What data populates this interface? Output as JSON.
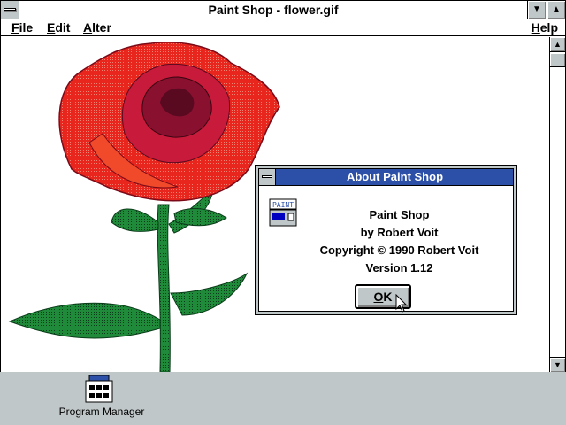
{
  "window": {
    "title": "Paint Shop - flower.gif",
    "minimize_glyph": "▼",
    "maximize_glyph": "▲"
  },
  "menu": {
    "file": {
      "hot": "F",
      "rest": "ile"
    },
    "edit": {
      "hot": "E",
      "rest": "dit"
    },
    "alter": {
      "hot": "A",
      "rest": "lter"
    },
    "help": {
      "hot": "H",
      "rest": "elp"
    }
  },
  "scrollbar": {
    "up_glyph": "▲",
    "down_glyph": "▼"
  },
  "dialog": {
    "title": "About Paint Shop",
    "app_name": "Paint Shop",
    "author": "by Robert Voit",
    "copyright": "Copyright © 1990 Robert Voit",
    "version": "Version 1.12",
    "ok": {
      "hot": "O",
      "rest": "K"
    },
    "icon_label": "PAINT"
  },
  "desktop": {
    "program_manager_label": "Program Manager"
  },
  "colors": {
    "desktop": "#c0c7c8",
    "dialog_title": "#2c50a8",
    "rose_red": "#e8261e",
    "rose_dark": "#8a1030",
    "leaf_green": "#1f8a3a"
  }
}
